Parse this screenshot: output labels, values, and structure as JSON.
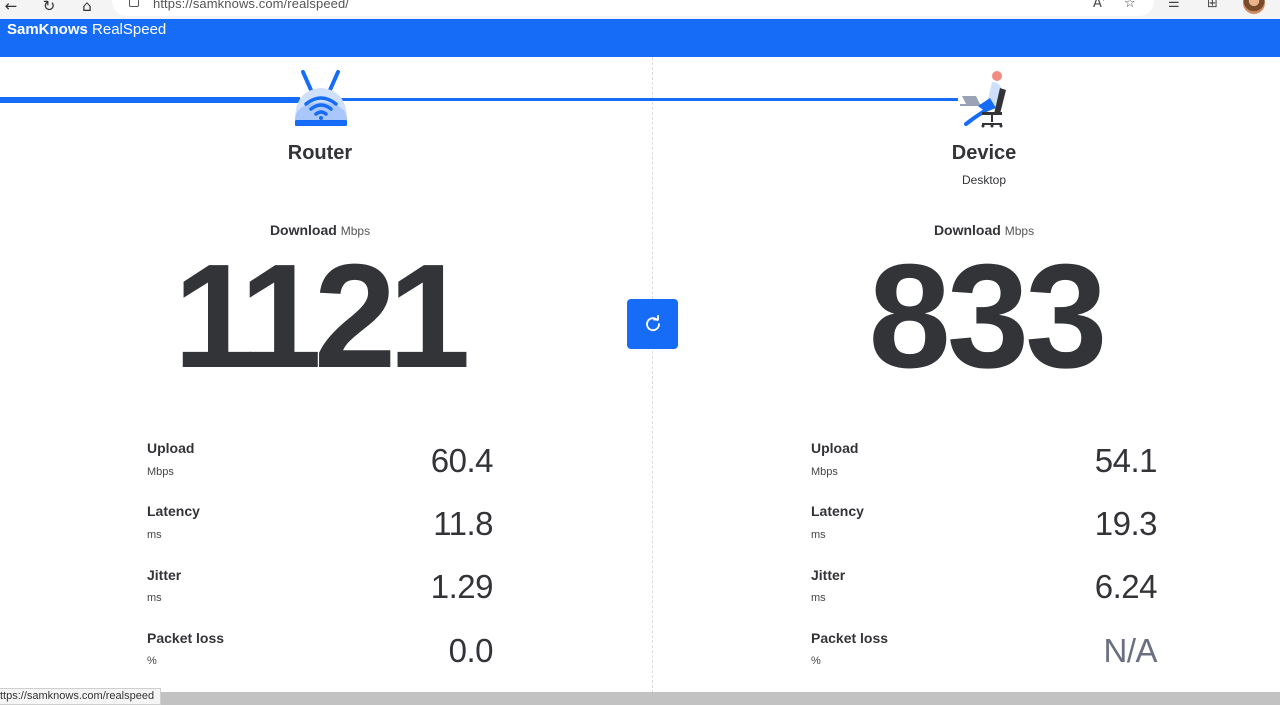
{
  "browser": {
    "url": "https://samknows.com/realspeed/",
    "read_aloud_label": "Aʼ",
    "status_url": "ttps://samknows.com/realspeed"
  },
  "brand": {
    "name_bold": "SamKnows",
    "name_light": "RealSpeed"
  },
  "router": {
    "title": "Router",
    "download_label": "Download",
    "download_unit": "Mbps",
    "download_value": "1121",
    "metrics": [
      {
        "label": "Upload",
        "unit": "Mbps",
        "value": "60.4"
      },
      {
        "label": "Latency",
        "unit": "ms",
        "value": "11.8"
      },
      {
        "label": "Jitter",
        "unit": "ms",
        "value": "1.29"
      },
      {
        "label": "Packet loss",
        "unit": "%",
        "value": "0.0"
      }
    ]
  },
  "device": {
    "title": "Device",
    "subtitle": "Desktop",
    "download_label": "Download",
    "download_unit": "Mbps",
    "download_value": "833",
    "metrics": [
      {
        "label": "Upload",
        "unit": "Mbps",
        "value": "54.1"
      },
      {
        "label": "Latency",
        "unit": "ms",
        "value": "19.3"
      },
      {
        "label": "Jitter",
        "unit": "ms",
        "value": "6.24"
      },
      {
        "label": "Packet loss",
        "unit": "%",
        "value": "N/A"
      }
    ]
  },
  "colors": {
    "accent": "#166cf7",
    "text": "#333438",
    "muted_value": "#6a6f82"
  },
  "icons": [
    "back-icon",
    "reload-icon",
    "home-icon",
    "page-icon",
    "read-aloud-icon",
    "favorites-icon",
    "collections-icon",
    "add-tab-icon",
    "refresh-icon",
    "router-icon",
    "device-icon"
  ]
}
